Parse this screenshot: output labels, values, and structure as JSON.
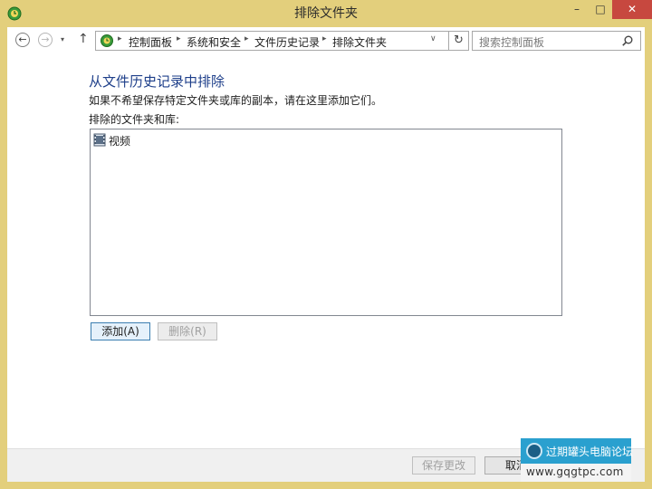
{
  "window": {
    "title": "排除文件夹",
    "minimize_glyph": "–",
    "maximize_glyph": "□",
    "close_glyph": "✕"
  },
  "nav": {
    "back_glyph": "←",
    "forward_glyph": "→",
    "recent_glyph": "▾",
    "up_glyph": "↑",
    "breadcrumbs": [
      "控制面板",
      "系统和安全",
      "文件历史记录",
      "排除文件夹"
    ],
    "separator_glyph": "▸",
    "dropdown_glyph": "∨",
    "refresh_glyph": "↻",
    "search_placeholder": "搜索控制面板"
  },
  "content": {
    "heading": "从文件历史记录中排除",
    "description": "如果不希望保存特定文件夹或库的副本，请在这里添加它们。",
    "list_label": "排除的文件夹和库:",
    "items": [
      {
        "label": "视频",
        "icon": "video-library-icon"
      }
    ],
    "add_button": "添加(A)",
    "remove_button": "删除(R)"
  },
  "footer": {
    "save_button": "保存更改",
    "cancel_button": "取消"
  },
  "watermark": {
    "title": "过期罐头电脑论坛",
    "url": "www.gqgtpc.com"
  },
  "colors": {
    "window_frame": "#e3cf7c",
    "heading": "#1e3f8a",
    "close_button": "#c7483f",
    "watermark": "#2aa0cf"
  }
}
